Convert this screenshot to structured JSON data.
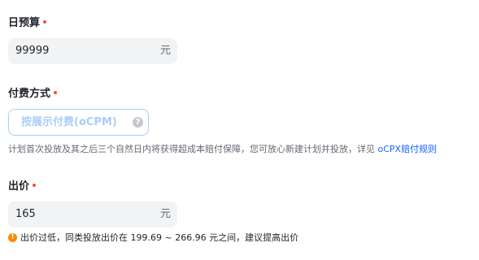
{
  "daily_budget": {
    "label": "日预算",
    "value": "99999",
    "unit": "元"
  },
  "pay_mode": {
    "label": "付费方式",
    "selected": "按展示付费(oCPM)",
    "help_icon": "question-circle-icon",
    "description": "计划首次投放及其之后三个自然日内将获得超成本赔付保障，您可放心新建计划并投放，详见",
    "rule_link": "oCPX赔付规则"
  },
  "bid": {
    "label": "出价",
    "value": "165",
    "unit": "元",
    "warning_icon": "warning-circle-icon",
    "warning": "出价过低，同类投放出价在 199.69 ~ 266.96 元之间，建议提高出价"
  },
  "colors": {
    "required_dot": "#f54a45",
    "link": "#1664ff",
    "warning": "#ff8800",
    "mode_border": "#a9cdfb"
  }
}
